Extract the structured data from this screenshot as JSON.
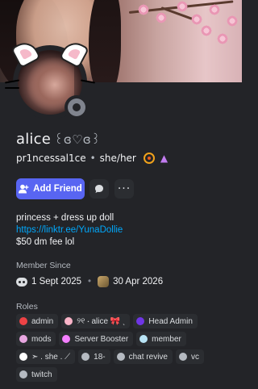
{
  "profile": {
    "display_name": "alice",
    "name_symbols": "꒰ɞ♡ɞ꒱",
    "username": "pr1ncessal1ce",
    "pronouns": "she/her",
    "separator": "•"
  },
  "actions": {
    "add_friend_label": "Add Friend",
    "more_label": "···"
  },
  "bio": {
    "line1": "princess + dress up doll",
    "link": "https://linktr.ee/YunaDollie",
    "line3": "$50 dm fee lol"
  },
  "member_since": {
    "title": "Member Since",
    "discord_date": "1 Sept 2025",
    "server_date": "30 Apr 2026"
  },
  "roles": {
    "title": "Roles",
    "items": [
      {
        "label": "admin",
        "color": "#ed4245"
      },
      {
        "label": "୨୧ ⋅ alice 🎀 ˎ",
        "color": "#f9b4c8"
      },
      {
        "label": "Head Admin",
        "color": "#6f35e6"
      },
      {
        "label": "mods",
        "color": "#e8a6e0"
      },
      {
        "label": "Server Booster",
        "color": "#f47fff"
      },
      {
        "label": "member",
        "color": "#b8e3f5"
      },
      {
        "label": "➣ . she . ⟋",
        "color": "#ffffff"
      },
      {
        "label": "18-",
        "color": "#b5bac1"
      },
      {
        "label": "chat revive",
        "color": "#b5bac1"
      },
      {
        "label": "vc",
        "color": "#b5bac1"
      },
      {
        "label": "twitch",
        "color": "#b5bac1"
      }
    ]
  },
  "colors": {
    "accent": "#5865f2",
    "link": "#00a8fc",
    "background": "#232428"
  }
}
